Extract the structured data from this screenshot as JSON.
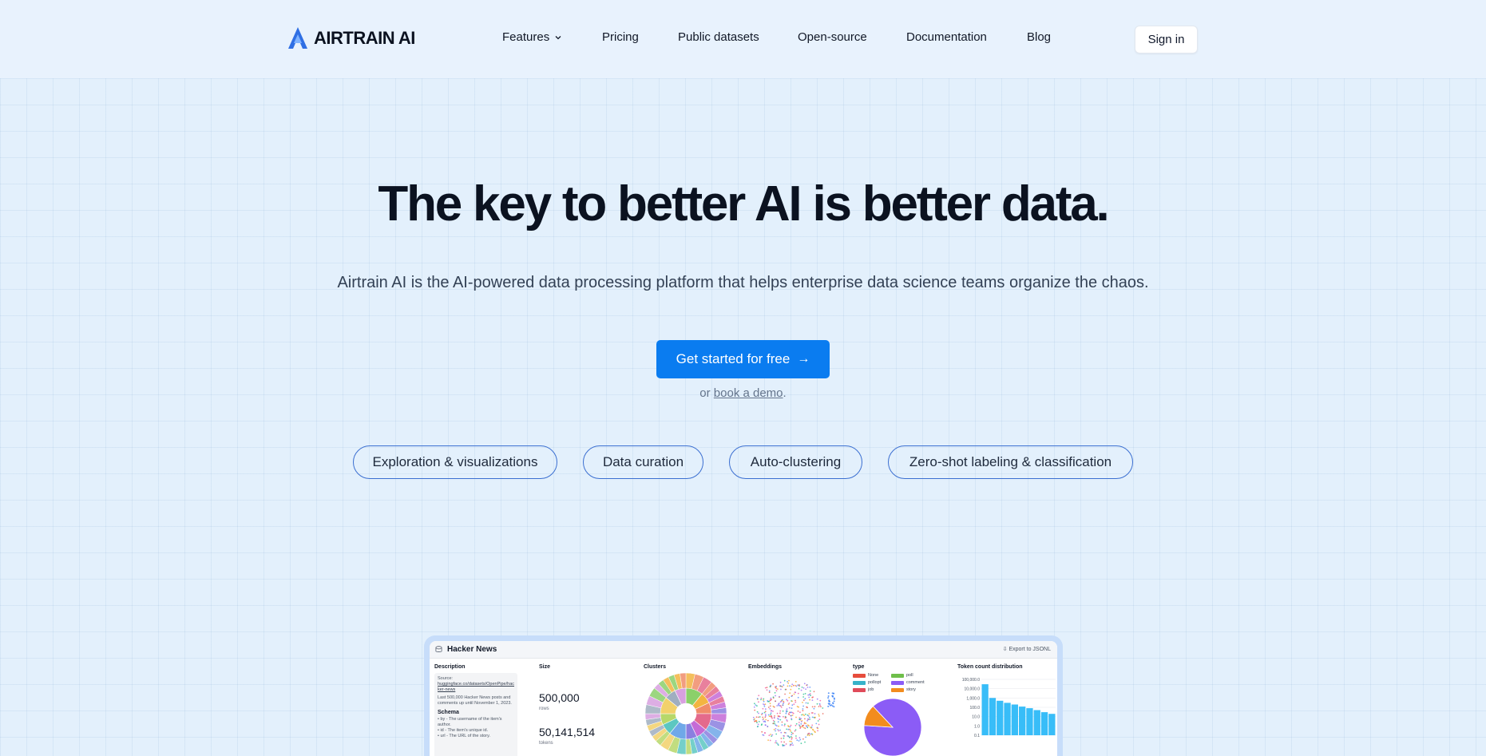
{
  "brand": {
    "name": "AIRTRAIN AI"
  },
  "nav": {
    "items": [
      {
        "label": "Features",
        "has_dropdown": true
      },
      {
        "label": "Pricing"
      },
      {
        "label": "Public datasets"
      },
      {
        "label": "Open-source"
      },
      {
        "label": "Documentation"
      },
      {
        "label": "Blog"
      }
    ],
    "signin_label": "Sign in"
  },
  "hero": {
    "title": "The key to better AI is better data.",
    "subtitle": "Airtrain AI is the AI-powered data processing platform that helps enterprise data science teams organize the chaos.",
    "cta_label": "Get started for free",
    "cta_arrow": "→",
    "demo_prefix": "or ",
    "demo_link": "book a demo",
    "demo_suffix": "."
  },
  "pills": [
    "Exploration & visualizations",
    "Data curation",
    "Auto-clustering",
    "Zero-shot labeling & classification"
  ],
  "colors": {
    "accent": "#0a7cf0",
    "pill_border": "#3b6fd1",
    "background": "#e8f2fd"
  },
  "preview": {
    "dataset_title": "Hacker News",
    "export_label": "Export to JSONL",
    "panels": {
      "description": "Description",
      "size": "Size",
      "clusters": "Clusters",
      "embeddings": "Embeddings",
      "type": "type",
      "token_dist": "Token count distribution"
    },
    "description": {
      "source_label": "Source:",
      "source_link": "huggingface.co/datasets/OpenPipe/hacker-news",
      "summary": "Last 500,000 Hacker News posts and comments up until November 1, 2023.",
      "schema_title": "Schema",
      "schema_items": [
        "• by - The username of the item's author.",
        "• id - The item's unique id.",
        "• url - The URL of the story."
      ]
    },
    "size": {
      "rows_value": "500,000",
      "rows_unit": "rows",
      "tokens_value": "50,141,514",
      "tokens_unit": "tokens"
    },
    "type_legend": [
      {
        "label": "None",
        "color": "#e74c3c"
      },
      {
        "label": "poll",
        "color": "#6fbf4a"
      },
      {
        "label": "pollopt",
        "color": "#38b2c9"
      },
      {
        "label": "comment",
        "color": "#8b5cf6"
      },
      {
        "label": "job",
        "color": "#e04b5a"
      },
      {
        "label": "story",
        "color": "#f28c1e"
      }
    ],
    "token_axis": [
      "100,000.0",
      "10,000.0",
      "1,000.0",
      "100.0",
      "10.0",
      "1.0",
      "0.1"
    ]
  },
  "chart_data": [
    {
      "type": "pie",
      "title": "type",
      "categories": [
        "comment",
        "story"
      ],
      "values": [
        88,
        12
      ]
    },
    {
      "type": "bar",
      "title": "Token count distribution",
      "ylim": [
        0.1,
        100000
      ],
      "y_scale": "log",
      "values": [
        30000,
        1000,
        500,
        300,
        200,
        120,
        80,
        50,
        30,
        20
      ]
    }
  ]
}
